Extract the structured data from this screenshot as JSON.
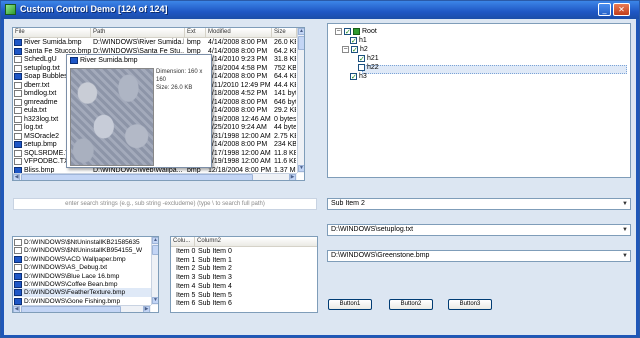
{
  "window": {
    "title": "Custom Control Demo [124 of 124]",
    "minimize_glyph": "_",
    "close_glyph": "✕"
  },
  "file_list": {
    "columns": [
      "File",
      "Path",
      "Ext",
      "Modified",
      "Size"
    ],
    "rows": [
      {
        "name": "River Sumida.bmp",
        "path": "D:\\WINDOWS\\River Sumida.bmp",
        "ext": "bmp",
        "modified": "4/14/2008 8:00 PM",
        "size": "26.0 KB",
        "type": "bmp"
      },
      {
        "name": "Santa Fe Stucco.bmp",
        "path": "D:\\WINDOWS\\Santa Fe Stu...",
        "ext": "bmp",
        "modified": "4/14/2008 8:00 PM",
        "size": "64.2 KB",
        "type": "bmp"
      },
      {
        "name": "SchedLgU",
        "path": "",
        "ext": "",
        "modified": "4/14/2010 9:23 PM",
        "size": "31.8 KB",
        "type": "txt"
      },
      {
        "name": "setuplog.txt",
        "path": "",
        "ext": "",
        "modified": "4/18/2004 4:58 PM",
        "size": "752 KB",
        "type": "txt"
      },
      {
        "name": "Soap Bubbles",
        "path": "",
        "ext": "",
        "modified": "4/14/2008 8:00 PM",
        "size": "64.4 KB",
        "type": "bmp"
      },
      {
        "name": "dberr.txt",
        "path": "",
        "ext": "",
        "modified": "3/11/2010 12:49 PM",
        "size": "44.4 KB",
        "type": "txt"
      },
      {
        "name": "bmdlog.txt",
        "path": "",
        "ext": "",
        "modified": "4/18/2008 4:52 PM",
        "size": "141 bytes",
        "type": "txt"
      },
      {
        "name": "gmreadme",
        "path": "",
        "ext": "",
        "modified": "4/14/2008 8:00 PM",
        "size": "646 bytes",
        "type": "txt"
      },
      {
        "name": "eula.txt",
        "path": "",
        "ext": "",
        "modified": "4/14/2008 8:00 PM",
        "size": "29.2 KB",
        "type": "txt"
      },
      {
        "name": "h323log.txt",
        "path": "",
        "ext": "",
        "modified": "3/19/2008 12:46 AM",
        "size": "0 bytes",
        "type": "txt"
      },
      {
        "name": "log.txt",
        "path": "",
        "ext": "",
        "modified": "4/25/2010 9:24 AM",
        "size": "44 bytes",
        "type": "txt"
      },
      {
        "name": "MSOracle2",
        "path": "",
        "ext": "",
        "modified": "3/31/1998 12:00 AM",
        "size": "2.75 KB",
        "type": "txt"
      },
      {
        "name": "setup.bmp",
        "path": "",
        "ext": "",
        "modified": "4/14/2008 8:00 PM",
        "size": "234 KB",
        "type": "bmp"
      },
      {
        "name": "SQLSRDME.TXT",
        "path": "D:\\WINDOWS\\system32\\S...",
        "ext": "TXT",
        "modified": "6/17/1998 12:00 AM",
        "size": "11.8 KB",
        "type": "txt"
      },
      {
        "name": "VFPODBC.TXT",
        "path": "D:\\WINDOWS\\system32\\V...",
        "ext": "TXT",
        "modified": "5/19/1998 12:00 AM",
        "size": "11.6 KB",
        "type": "txt"
      },
      {
        "name": "Bliss.bmp",
        "path": "D:\\WINDOWS\\Web\\Wallpa...",
        "ext": "bmp",
        "modified": "12/18/2004 8:00 PM",
        "size": "1.37 MB",
        "type": "bmp"
      }
    ]
  },
  "preview_tip": {
    "title": "River Sumida.bmp",
    "dimension": "Dimension: 160 x 160",
    "size": "Size: 26.0 KB"
  },
  "tree": {
    "nodes": [
      {
        "label": "Root",
        "expander": "−",
        "checked": true
      },
      {
        "label": "h1",
        "checked": true
      },
      {
        "label": "h2",
        "expander": "−",
        "checked": true
      },
      {
        "label": "h21",
        "checked": true
      },
      {
        "label": "h22",
        "checked": false
      },
      {
        "label": "h3",
        "checked": true
      }
    ],
    "check_glyph": "✓"
  },
  "search": {
    "placeholder": "enter search strings (e.g., sub string -excludeme) (type \\ to search full path)"
  },
  "combos": {
    "sub_item": "Sub Item 2",
    "file_path": "D:\\WINDOWS\\setuplog.txt",
    "file_path2": "D:\\WINDOWS\\Greenstone.bmp",
    "arrow": "▼"
  },
  "path_list": {
    "items": [
      {
        "text": "D:\\WINDOWS\\$NtUninstallKB21585635",
        "type": "txt"
      },
      {
        "text": "D:\\WINDOWS\\$NtUninstallKB954155_W",
        "type": "txt"
      },
      {
        "text": "D:\\WINDOWS\\ACD Wallpaper.bmp",
        "type": "bmp"
      },
      {
        "text": "D:\\WINDOWS\\AS_Debug.txt",
        "type": "txt"
      },
      {
        "text": "D:\\WINDOWS\\Blue Lace 16.bmp",
        "type": "bmp"
      },
      {
        "text": "D:\\WINDOWS\\Coffee Bean.bmp",
        "type": "bmp"
      },
      {
        "text": "D:\\WINDOWS\\FeatherTexture.bmp",
        "type": "bmp"
      },
      {
        "text": "D:\\WINDOWS\\Gone Fishing.bmp",
        "type": "bmp"
      }
    ]
  },
  "grid": {
    "columns": [
      "Colu...",
      "Column2"
    ],
    "rows": [
      [
        "Item 0",
        "Sub Item 0"
      ],
      [
        "Item 1",
        "Sub Item 1"
      ],
      [
        "Item 2",
        "Sub Item 2"
      ],
      [
        "Item 3",
        "Sub Item 3"
      ],
      [
        "Item 4",
        "Sub Item 4"
      ],
      [
        "Item 5",
        "Sub Item 5"
      ],
      [
        "Item 6",
        "Sub Item 6"
      ]
    ]
  },
  "buttons": {
    "b1": "Button1",
    "b2": "Button2",
    "b3": "Button3"
  },
  "scroll": {
    "up": "▲",
    "down": "▼",
    "left": "◀",
    "right": "▶"
  }
}
